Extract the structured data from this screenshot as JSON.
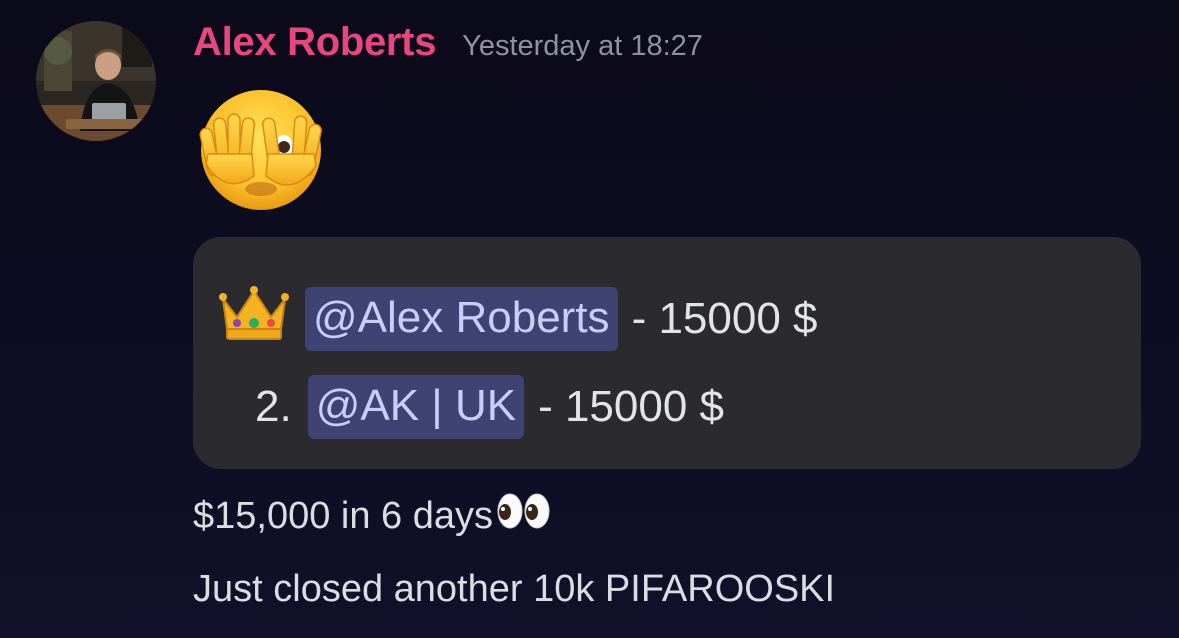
{
  "message": {
    "author": "Alex Roberts",
    "timestamp": "Yesterday at 18:27",
    "avatar_icon": "user-avatar-photo",
    "big_emoji": "face-with-hands-over-eyes-emoji",
    "embed": {
      "leaderboard": [
        {
          "rank_icon": "crown-icon",
          "rank_label": "",
          "mention": "@Alex Roberts",
          "amount": "- 15000 $"
        },
        {
          "rank_icon": "",
          "rank_label": "2.",
          "mention": "@AK | UK",
          "amount": "- 15000 $"
        }
      ]
    },
    "lines": [
      {
        "text": "$15,000 in 6 days",
        "trailing_icon": "eyes-emoji-icon"
      },
      {
        "text": "Just closed another 10k PIFAROOSKI"
      }
    ]
  },
  "colors": {
    "background": "#0e0c22",
    "author": "#e9457e",
    "timestamp": "#8f91a0",
    "embed_bg": "#2b2b2f",
    "mention_bg": "#3e4373",
    "mention_text": "#c9cdf8",
    "text": "#dcdde3"
  }
}
